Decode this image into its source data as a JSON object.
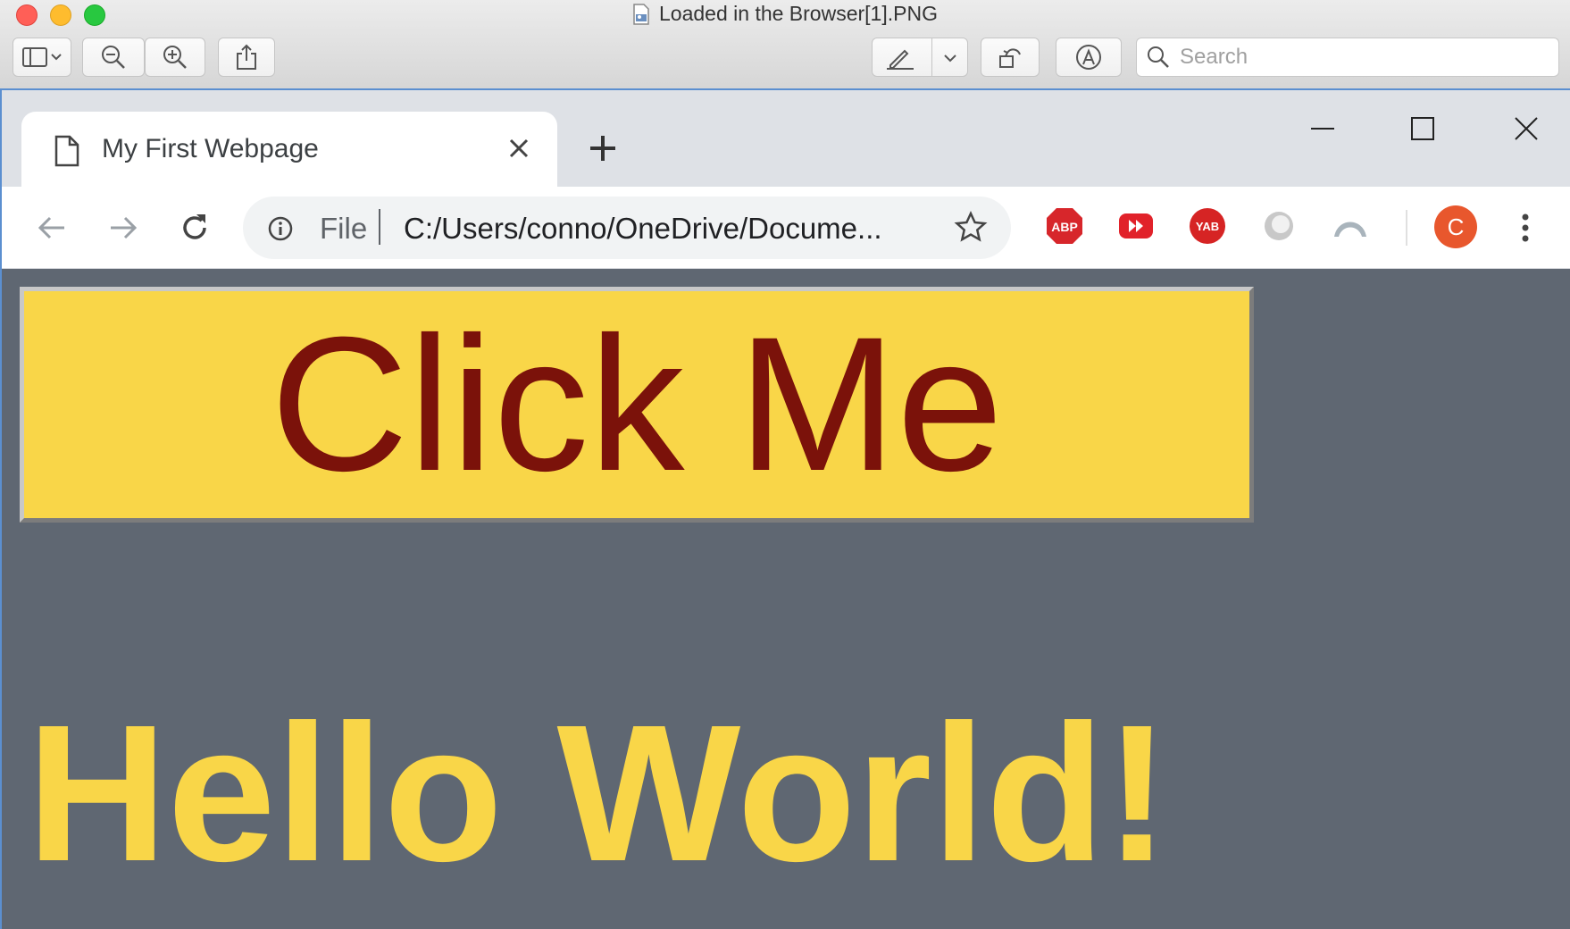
{
  "preview": {
    "window_title": "Loaded in the Browser[1].PNG",
    "search_placeholder": "Search"
  },
  "browser": {
    "tab_title": "My First Webpage",
    "address": {
      "scheme": "File",
      "url": "C:/Users/conno/OneDrive/Docume..."
    },
    "extensions": [
      {
        "name": "adblock-plus",
        "label": "ABP"
      },
      {
        "name": "video-speed",
        "label": ""
      },
      {
        "name": "yab",
        "label": "YAB"
      },
      {
        "name": "circle-extension",
        "label": ""
      },
      {
        "name": "arch-extension",
        "label": ""
      }
    ],
    "profile_initial": "C"
  },
  "page": {
    "button_label": "Click Me",
    "heading": "Hello World!"
  },
  "colors": {
    "page_background": "#5f6772",
    "button_background": "#f9d648",
    "button_text": "#7b120a",
    "heading_text": "#f9d648",
    "profile_avatar": "#e8572d"
  }
}
